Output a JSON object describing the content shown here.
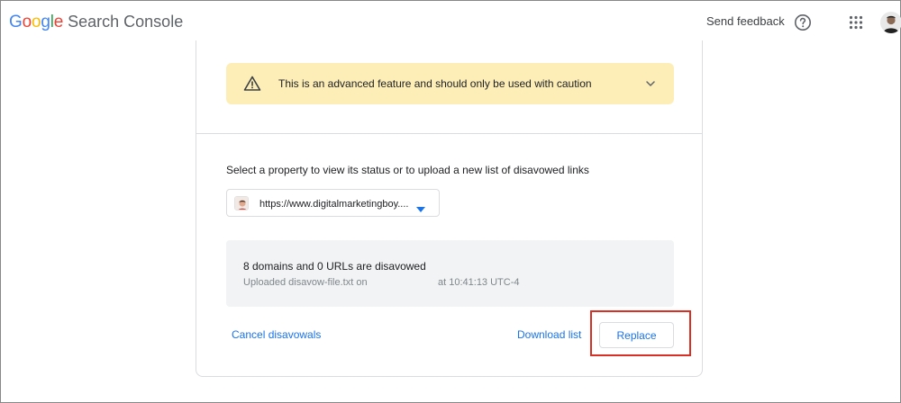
{
  "header": {
    "logo_letters": [
      "G",
      "o",
      "o",
      "g",
      "l",
      "e"
    ],
    "product_name": "Search Console",
    "send_feedback": "Send feedback",
    "icons": [
      "help-circle-icon",
      "apps-grid-icon",
      "avatar"
    ]
  },
  "warning": {
    "text": "This is an advanced feature and should only be used with caution",
    "icon": "warning-triangle-icon",
    "expand_icon": "chevron-down-icon",
    "background": "#fdeeb8"
  },
  "property": {
    "label": "Select a property to view its status or to upload a new list of disavowed links",
    "selected_url": "https://www.digitalmarketingboy....",
    "dropdown_icon": "caret-down-icon"
  },
  "status": {
    "summary": "8 domains and 0 URLs are disavowed",
    "uploaded": "Uploaded disavow-file.txt on",
    "uploaded_time": "at 10:41:13 UTC-4"
  },
  "actions": {
    "cancel": "Cancel disavowals",
    "download": "Download list",
    "replace": "Replace"
  },
  "colors": {
    "accent": "#1a73e8",
    "highlight": "#d93025",
    "status_bg": "#f1f3f4"
  }
}
